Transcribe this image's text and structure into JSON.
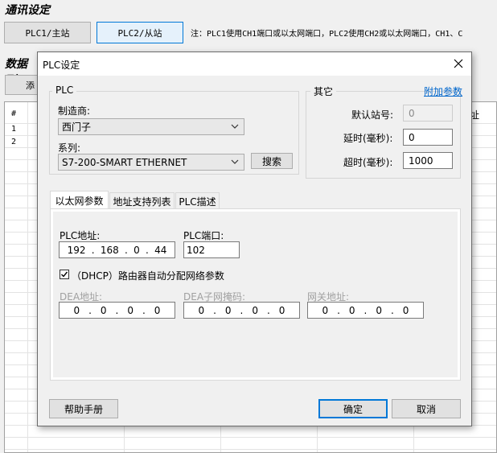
{
  "background": {
    "comm_title": "通讯设定",
    "plc1_button": "PLC1/主站",
    "plc2_button": "PLC2/从站",
    "note": "注：PLC1使用CH1端口或以太网端口，PLC2使用CH2或以太网端口，CH1、C",
    "data_title": "数据列",
    "partial_button": "添",
    "table": {
      "header_hash": "#",
      "header_right": "址",
      "rows": [
        "1",
        "2"
      ]
    }
  },
  "dialog": {
    "title": "PLC设定",
    "plc_group": {
      "label": "PLC",
      "manufacturer_label": "制造商:",
      "manufacturer_value": "西门子",
      "series_label": "系列:",
      "series_value": "S7-200-SMART ETHERNET",
      "search_button": "搜索"
    },
    "other_group": {
      "label": "其它",
      "extra_link": "附加参数",
      "default_station_label": "默认站号:",
      "default_station_value": "0",
      "delay_label": "延时(毫秒):",
      "delay_value": "0",
      "timeout_label": "超时(毫秒):",
      "timeout_value": "1000"
    },
    "tabs": [
      "以太网参数",
      "地址支持列表",
      "PLC描述"
    ],
    "ethernet": {
      "plc_address_label": "PLC地址:",
      "plc_address": [
        "192",
        "168",
        "0",
        "44"
      ],
      "plc_port_label": "PLC端口:",
      "plc_port_value": "102",
      "dhcp_label": "（DHCP）路由器自动分配网络参数",
      "dhcp_checked": true,
      "dea_address_label": "DEA地址:",
      "dea_address": [
        "0",
        "0",
        "0",
        "0"
      ],
      "subnet_label": "DEA子网掩码:",
      "subnet": [
        "0",
        "0",
        "0",
        "0"
      ],
      "gateway_label": "网关地址:",
      "gateway": [
        "0",
        "0",
        "0",
        "0"
      ]
    },
    "help_button": "帮助手册",
    "ok_button": "确定",
    "cancel_button": "取消"
  },
  "colors": {
    "accent": "#0078d7",
    "link": "#0066cc",
    "dialog_bg": "#f0f0f0"
  }
}
